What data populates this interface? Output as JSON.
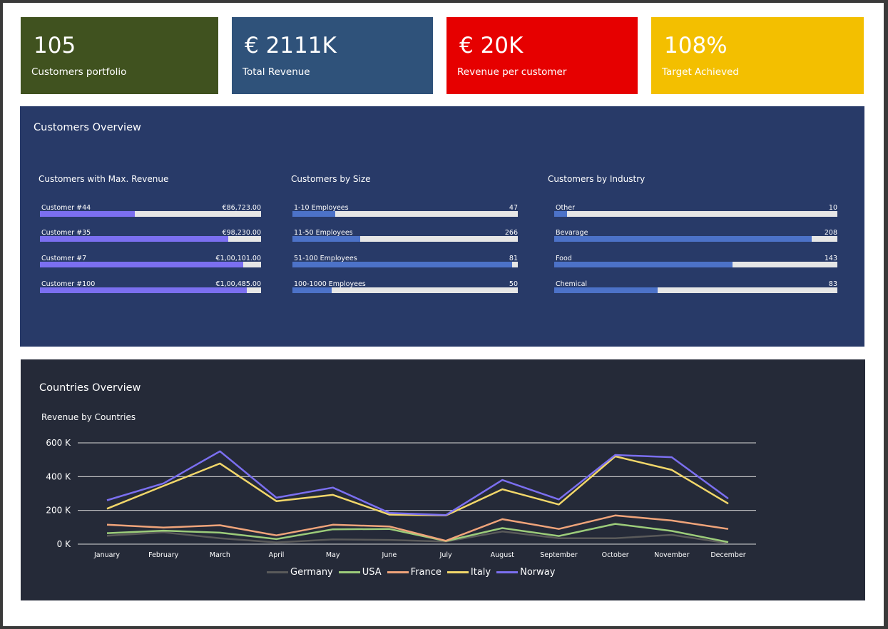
{
  "kpis": [
    {
      "value": "105",
      "label": "Customers portfolio",
      "color": "#40521f"
    },
    {
      "value": "€ 2111K",
      "label": "Total Revenue",
      "color": "#2f527a"
    },
    {
      "value": "€ 20K",
      "label": "Revenue per customer",
      "color": "#e60000"
    },
    {
      "value": "108%",
      "label": "Target Achieved",
      "color": "#f3bf00"
    }
  ],
  "customers_overview": {
    "title": "Customers Overview",
    "max_revenue": {
      "title": "Customers with Max. Revenue",
      "fill_color": "#7b6ff0",
      "items": [
        {
          "label": "Customer #44",
          "value_text": "€86,723.00",
          "fraction": 0.43
        },
        {
          "label": "Customer #35",
          "value_text": "€98,230.00",
          "fraction": 0.85
        },
        {
          "label": "Customer #7",
          "value_text": "€1,00,101.00",
          "fraction": 0.92
        },
        {
          "label": "Customer #100",
          "value_text": "€1,00,485.00",
          "fraction": 0.935
        }
      ]
    },
    "by_size": {
      "title": "Customers by Size",
      "fill_color": "#4c72c8",
      "items": [
        {
          "label": "1-10 Employees",
          "value_text": "47",
          "fraction": 0.19
        },
        {
          "label": "11-50 Employees",
          "value_text": "266",
          "fraction": 0.3
        },
        {
          "label": "51-100 Employees",
          "value_text": "81",
          "fraction": 0.975
        },
        {
          "label": "100-1000 Employees",
          "value_text": "50",
          "fraction": 0.175
        }
      ]
    },
    "by_industry": {
      "title": "Customers by Industry",
      "fill_color": "#4c72c8",
      "items": [
        {
          "label": "Other",
          "value_text": "10",
          "fraction": 0.045
        },
        {
          "label": "Bevarage",
          "value_text": "208",
          "fraction": 0.91
        },
        {
          "label": "Food",
          "value_text": "143",
          "fraction": 0.63
        },
        {
          "label": "Chemical",
          "value_text": "83",
          "fraction": 0.365
        }
      ]
    }
  },
  "countries_overview": {
    "title": "Countries Overview",
    "chart_title": "Revenue by Countries"
  },
  "chart_data": {
    "type": "line",
    "title": "Revenue by Countries",
    "categories": [
      "January",
      "February",
      "March",
      "April",
      "May",
      "June",
      "July",
      "August",
      "September",
      "October",
      "November",
      "December"
    ],
    "ylim": [
      0,
      600000
    ],
    "yticks": [
      0,
      200000,
      400000,
      600000
    ],
    "ytick_labels": [
      "0 K",
      "200 K",
      "400 K",
      "600 K"
    ],
    "grid": true,
    "legend": "bottom",
    "series": [
      {
        "name": "Germany",
        "color": "#5a5a5a",
        "values": [
          50000,
          70000,
          35000,
          10000,
          28000,
          25000,
          15000,
          75000,
          35000,
          35000,
          55000,
          5000
        ]
      },
      {
        "name": "USA",
        "color": "#9ccc7a",
        "values": [
          65000,
          80000,
          68000,
          30000,
          88000,
          90000,
          18000,
          95000,
          48000,
          120000,
          78000,
          12000
        ]
      },
      {
        "name": "France",
        "color": "#f0a47a",
        "values": [
          115000,
          98000,
          112000,
          52000,
          115000,
          105000,
          20000,
          148000,
          90000,
          170000,
          140000,
          90000
        ]
      },
      {
        "name": "Italy",
        "color": "#f2d76a",
        "values": [
          210000,
          345000,
          478000,
          255000,
          292000,
          175000,
          170000,
          325000,
          235000,
          520000,
          440000,
          240000
        ]
      },
      {
        "name": "Norway",
        "color": "#7b6ff0",
        "values": [
          260000,
          360000,
          550000,
          275000,
          335000,
          185000,
          172000,
          380000,
          265000,
          528000,
          515000,
          270000
        ]
      }
    ]
  }
}
